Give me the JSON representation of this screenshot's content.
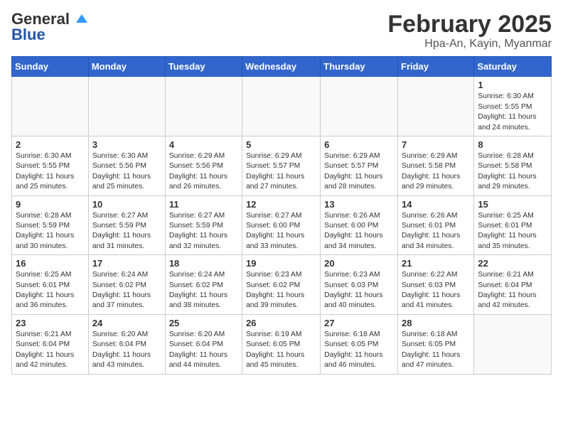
{
  "logo": {
    "general": "General",
    "blue": "Blue",
    "tagline": ""
  },
  "title": "February 2025",
  "location": "Hpa-An, Kayin, Myanmar",
  "weekdays": [
    "Sunday",
    "Monday",
    "Tuesday",
    "Wednesday",
    "Thursday",
    "Friday",
    "Saturday"
  ],
  "weeks": [
    [
      {
        "day": "",
        "info": ""
      },
      {
        "day": "",
        "info": ""
      },
      {
        "day": "",
        "info": ""
      },
      {
        "day": "",
        "info": ""
      },
      {
        "day": "",
        "info": ""
      },
      {
        "day": "",
        "info": ""
      },
      {
        "day": "1",
        "info": "Sunrise: 6:30 AM\nSunset: 5:55 PM\nDaylight: 11 hours and 24 minutes."
      }
    ],
    [
      {
        "day": "2",
        "info": "Sunrise: 6:30 AM\nSunset: 5:55 PM\nDaylight: 11 hours and 25 minutes."
      },
      {
        "day": "3",
        "info": "Sunrise: 6:30 AM\nSunset: 5:56 PM\nDaylight: 11 hours and 25 minutes."
      },
      {
        "day": "4",
        "info": "Sunrise: 6:29 AM\nSunset: 5:56 PM\nDaylight: 11 hours and 26 minutes."
      },
      {
        "day": "5",
        "info": "Sunrise: 6:29 AM\nSunset: 5:57 PM\nDaylight: 11 hours and 27 minutes."
      },
      {
        "day": "6",
        "info": "Sunrise: 6:29 AM\nSunset: 5:57 PM\nDaylight: 11 hours and 28 minutes."
      },
      {
        "day": "7",
        "info": "Sunrise: 6:29 AM\nSunset: 5:58 PM\nDaylight: 11 hours and 29 minutes."
      },
      {
        "day": "8",
        "info": "Sunrise: 6:28 AM\nSunset: 5:58 PM\nDaylight: 11 hours and 29 minutes."
      }
    ],
    [
      {
        "day": "9",
        "info": "Sunrise: 6:28 AM\nSunset: 5:59 PM\nDaylight: 11 hours and 30 minutes."
      },
      {
        "day": "10",
        "info": "Sunrise: 6:27 AM\nSunset: 5:59 PM\nDaylight: 11 hours and 31 minutes."
      },
      {
        "day": "11",
        "info": "Sunrise: 6:27 AM\nSunset: 5:59 PM\nDaylight: 11 hours and 32 minutes."
      },
      {
        "day": "12",
        "info": "Sunrise: 6:27 AM\nSunset: 6:00 PM\nDaylight: 11 hours and 33 minutes."
      },
      {
        "day": "13",
        "info": "Sunrise: 6:26 AM\nSunset: 6:00 PM\nDaylight: 11 hours and 34 minutes."
      },
      {
        "day": "14",
        "info": "Sunrise: 6:26 AM\nSunset: 6:01 PM\nDaylight: 11 hours and 34 minutes."
      },
      {
        "day": "15",
        "info": "Sunrise: 6:25 AM\nSunset: 6:01 PM\nDaylight: 11 hours and 35 minutes."
      }
    ],
    [
      {
        "day": "16",
        "info": "Sunrise: 6:25 AM\nSunset: 6:01 PM\nDaylight: 11 hours and 36 minutes."
      },
      {
        "day": "17",
        "info": "Sunrise: 6:24 AM\nSunset: 6:02 PM\nDaylight: 11 hours and 37 minutes."
      },
      {
        "day": "18",
        "info": "Sunrise: 6:24 AM\nSunset: 6:02 PM\nDaylight: 11 hours and 38 minutes."
      },
      {
        "day": "19",
        "info": "Sunrise: 6:23 AM\nSunset: 6:02 PM\nDaylight: 11 hours and 39 minutes."
      },
      {
        "day": "20",
        "info": "Sunrise: 6:23 AM\nSunset: 6:03 PM\nDaylight: 11 hours and 40 minutes."
      },
      {
        "day": "21",
        "info": "Sunrise: 6:22 AM\nSunset: 6:03 PM\nDaylight: 11 hours and 41 minutes."
      },
      {
        "day": "22",
        "info": "Sunrise: 6:21 AM\nSunset: 6:04 PM\nDaylight: 11 hours and 42 minutes."
      }
    ],
    [
      {
        "day": "23",
        "info": "Sunrise: 6:21 AM\nSunset: 6:04 PM\nDaylight: 11 hours and 42 minutes."
      },
      {
        "day": "24",
        "info": "Sunrise: 6:20 AM\nSunset: 6:04 PM\nDaylight: 11 hours and 43 minutes."
      },
      {
        "day": "25",
        "info": "Sunrise: 6:20 AM\nSunset: 6:04 PM\nDaylight: 11 hours and 44 minutes."
      },
      {
        "day": "26",
        "info": "Sunrise: 6:19 AM\nSunset: 6:05 PM\nDaylight: 11 hours and 45 minutes."
      },
      {
        "day": "27",
        "info": "Sunrise: 6:18 AM\nSunset: 6:05 PM\nDaylight: 11 hours and 46 minutes."
      },
      {
        "day": "28",
        "info": "Sunrise: 6:18 AM\nSunset: 6:05 PM\nDaylight: 11 hours and 47 minutes."
      },
      {
        "day": "",
        "info": ""
      }
    ]
  ]
}
